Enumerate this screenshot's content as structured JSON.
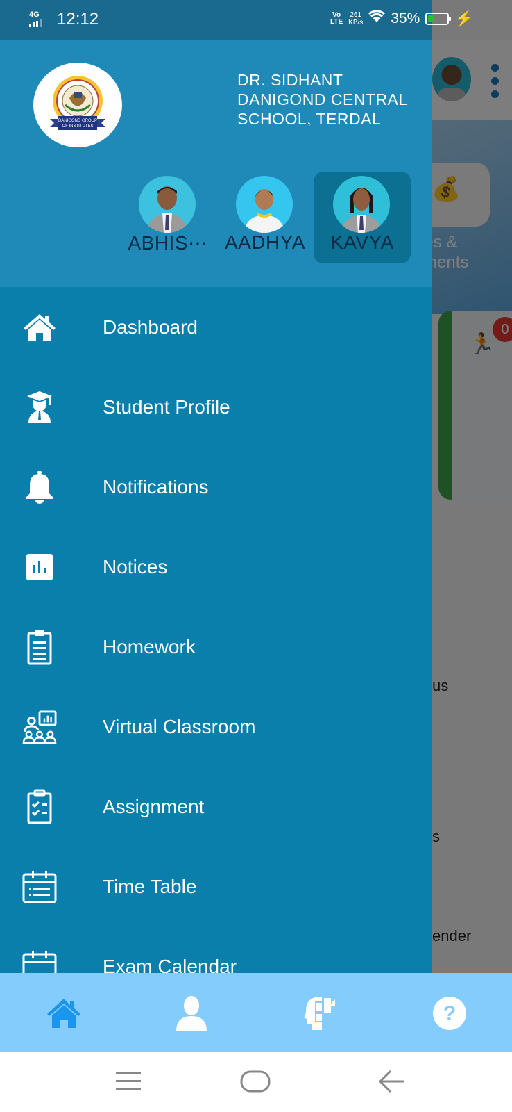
{
  "status_bar": {
    "network": "4G",
    "time": "12:12",
    "volte": "Vo LTE",
    "speed_value": "261",
    "speed_unit": "KB/s",
    "battery_percent": "35%",
    "battery_level": 0.35,
    "charging": true
  },
  "drawer": {
    "school_name": "DR. SIDHANT DANIGOND CENTRAL SCHOOL, TERDAL",
    "logo_caption": "DANIGOND GROUP OF INSTITUTES",
    "students": [
      {
        "name": "ABHIS⋯",
        "selected": false
      },
      {
        "name": "AADHYA",
        "selected": false
      },
      {
        "name": "KAVYA",
        "selected": true
      }
    ],
    "menu": [
      {
        "label": "Dashboard",
        "icon": "home-icon"
      },
      {
        "label": "Student Profile",
        "icon": "graduate-icon"
      },
      {
        "label": "Notifications",
        "icon": "bell-icon"
      },
      {
        "label": "Notices",
        "icon": "chart-board-icon"
      },
      {
        "label": "Homework",
        "icon": "clipboard-list-icon"
      },
      {
        "label": "Virtual Classroom",
        "icon": "classroom-icon"
      },
      {
        "label": "Assignment",
        "icon": "clipboard-check-icon"
      },
      {
        "label": "Time Table",
        "icon": "calendar-list-icon"
      },
      {
        "label": "Exam Calendar",
        "icon": "calendar-icon"
      }
    ]
  },
  "background": {
    "fees_label": "Fees &\nPayments",
    "fees_label_visible": "ees &\nyments",
    "badge_count": "0",
    "partial_labels": [
      "us",
      "s",
      "ender"
    ]
  },
  "bottom_nav": {
    "items": [
      {
        "name": "home",
        "icon": "home-icon",
        "active": true
      },
      {
        "name": "profile",
        "icon": "person-icon",
        "active": false
      },
      {
        "name": "learning",
        "icon": "head-puzzle-icon",
        "active": false
      },
      {
        "name": "help",
        "icon": "help-icon",
        "active": false
      }
    ],
    "active_color": "#1a96f0",
    "inactive_color": "#ffffff",
    "background": "#84ccfc"
  },
  "colors": {
    "drawer_header": "#1f8ab8",
    "drawer_body": "#0b7fab",
    "selected_student": "#0c7092"
  }
}
